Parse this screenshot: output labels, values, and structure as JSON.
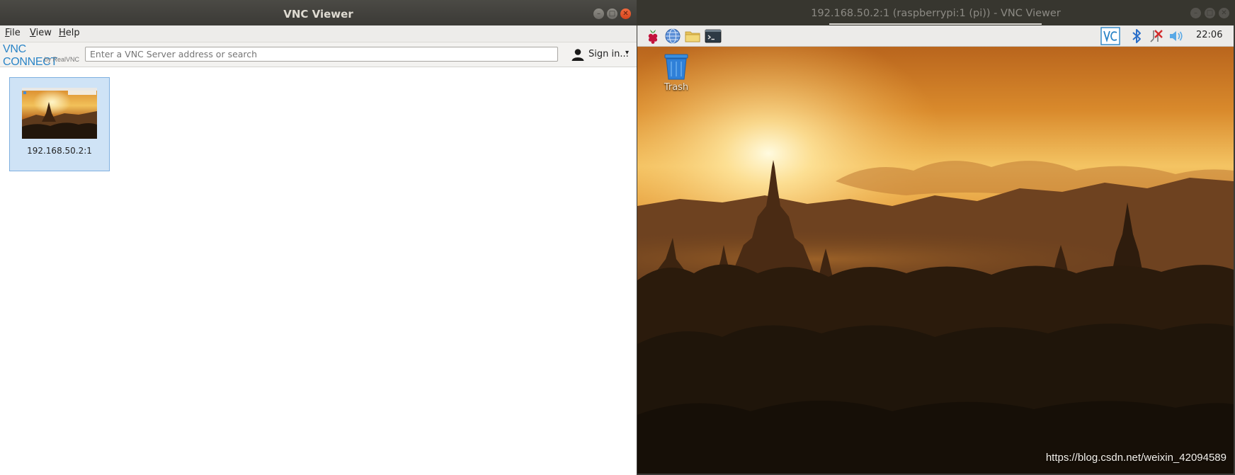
{
  "left_window": {
    "title": "VNC Viewer",
    "menu": [
      {
        "label": "File",
        "mnemonic": "F",
        "rest": "ile"
      },
      {
        "label": "View",
        "mnemonic": "V",
        "rest": "iew"
      },
      {
        "label": "Help",
        "mnemonic": "H",
        "rest": "elp"
      }
    ],
    "logo": {
      "line1": "VNC CONNECT",
      "line2": "by RealVNC"
    },
    "search": {
      "placeholder": "Enter a VNC Server address or search",
      "value": ""
    },
    "sign_in": {
      "label": "Sign in...",
      "caret": "▾"
    },
    "connections": [
      {
        "label": "192.168.50.2:1",
        "selected": true
      }
    ]
  },
  "right_window": {
    "title": "192.168.50.2:1 (raspberrypi:1 (pi)) - VNC Viewer",
    "panel": {
      "launchers": [
        "raspberry-menu-icon",
        "web-browser-icon",
        "file-manager-icon",
        "terminal-icon"
      ],
      "tray": [
        "vnc-server-icon",
        "bluetooth-icon",
        "network-disconnected-icon",
        "volume-icon"
      ],
      "clock": "22:06"
    },
    "desktop": {
      "icons": [
        {
          "label": "Trash",
          "icon": "trash-icon"
        }
      ]
    },
    "watermark": "https://blog.csdn.net/weixin_42094589"
  },
  "colors": {
    "titlebar": "#3b3a36",
    "close_button": "#e2552b",
    "selection": "#cfe3f6",
    "vnc_blue": "#2b85c7"
  }
}
